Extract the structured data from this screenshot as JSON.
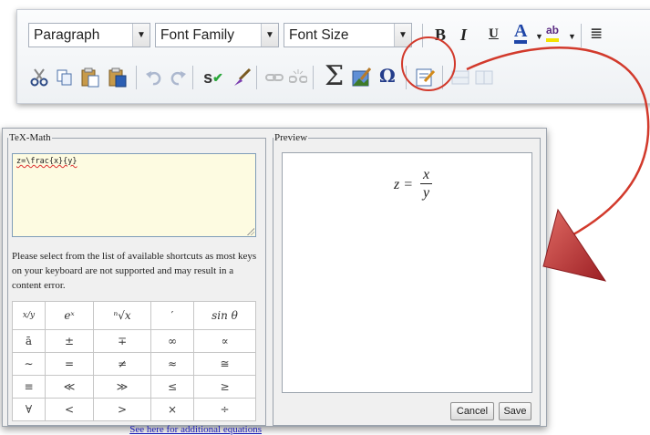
{
  "toolbar": {
    "paragraph": "Paragraph",
    "font_family": "Font Family",
    "font_size": "Font Size",
    "bold": "B",
    "italic": "I",
    "underline": "U",
    "font_color": "A",
    "highlight": "ab",
    "spellcheck": "s",
    "sigma": "Σ",
    "omega": "Ω"
  },
  "dialog": {
    "tex_legend": "TeX-Math",
    "tex_value": "z=\\frac{x}{y}",
    "note": "Please select from the list of available shortcuts as most keys on your keyboard are not supported and may result in a content error.",
    "shortcuts": [
      [
        "x/y",
        "eˣ",
        "ⁿ√x",
        "′",
        "sin θ"
      ],
      [
        "ā",
        "±",
        "∓",
        "∞",
        "∝"
      ],
      [
        "∼",
        "=",
        "≠",
        "≈",
        "≅"
      ],
      [
        "≡",
        "≪",
        "≫",
        "≤",
        "≥"
      ],
      [
        "∀",
        "<",
        ">",
        "×",
        "÷"
      ]
    ],
    "more_link": "See here for additional equations",
    "preview_legend": "Preview",
    "preview_lhs": "z =",
    "preview_num": "x",
    "preview_den": "y",
    "cancel": "Cancel",
    "save": "Save"
  },
  "colors": {
    "accent_red": "#d23a2c",
    "arrow_fill": "#b82e30"
  }
}
